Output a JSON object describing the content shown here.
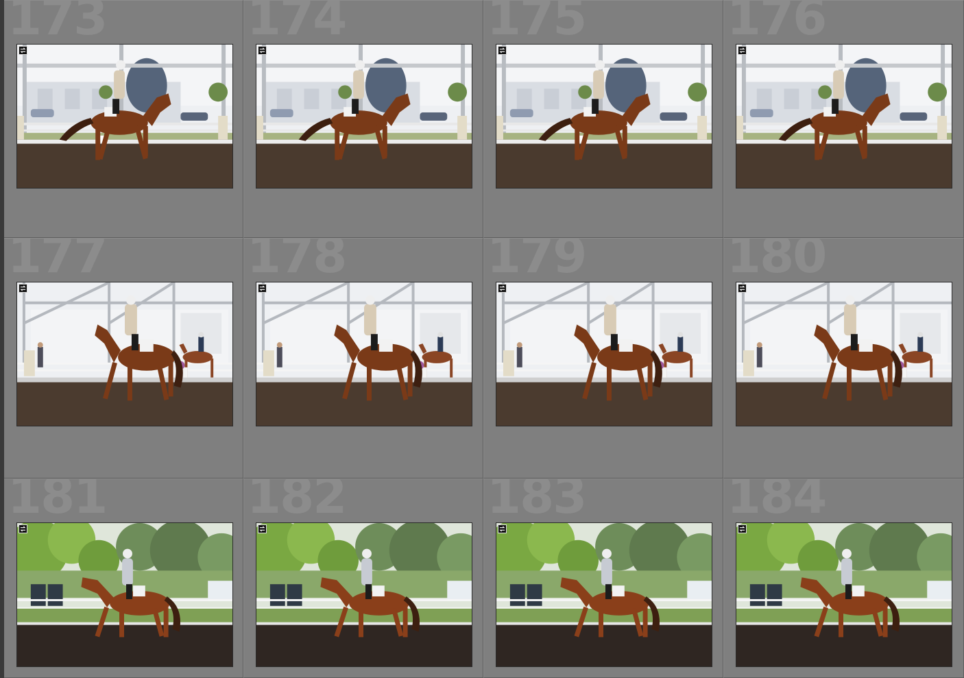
{
  "grid": {
    "cells": [
      {
        "index": "173",
        "scene": "indoor-left",
        "badge_icon": "sync-arrows-icon"
      },
      {
        "index": "174",
        "scene": "indoor-left",
        "badge_icon": "sync-arrows-icon"
      },
      {
        "index": "175",
        "scene": "indoor-left",
        "badge_icon": "sync-arrows-icon"
      },
      {
        "index": "176",
        "scene": "indoor-left",
        "badge_icon": "sync-arrows-icon"
      },
      {
        "index": "177",
        "scene": "indoor-right",
        "badge_icon": "sync-arrows-icon"
      },
      {
        "index": "178",
        "scene": "indoor-right",
        "badge_icon": "sync-arrows-icon"
      },
      {
        "index": "179",
        "scene": "indoor-right",
        "badge_icon": "sync-arrows-icon"
      },
      {
        "index": "180",
        "scene": "indoor-right",
        "badge_icon": "sync-arrows-icon"
      },
      {
        "index": "181",
        "scene": "outdoor",
        "badge_icon": "sync-arrows-icon"
      },
      {
        "index": "182",
        "scene": "outdoor",
        "badge_icon": "sync-arrows-icon"
      },
      {
        "index": "183",
        "scene": "outdoor",
        "badge_icon": "sync-arrows-icon"
      },
      {
        "index": "184",
        "scene": "outdoor",
        "badge_icon": "sync-arrows-icon"
      }
    ]
  },
  "colors": {
    "cell_bg": "#7f7f7f",
    "index_text": "#8c8c8c",
    "arena_dirt": "#4a3a2e",
    "horse_chestnut": "#7a3a18"
  }
}
